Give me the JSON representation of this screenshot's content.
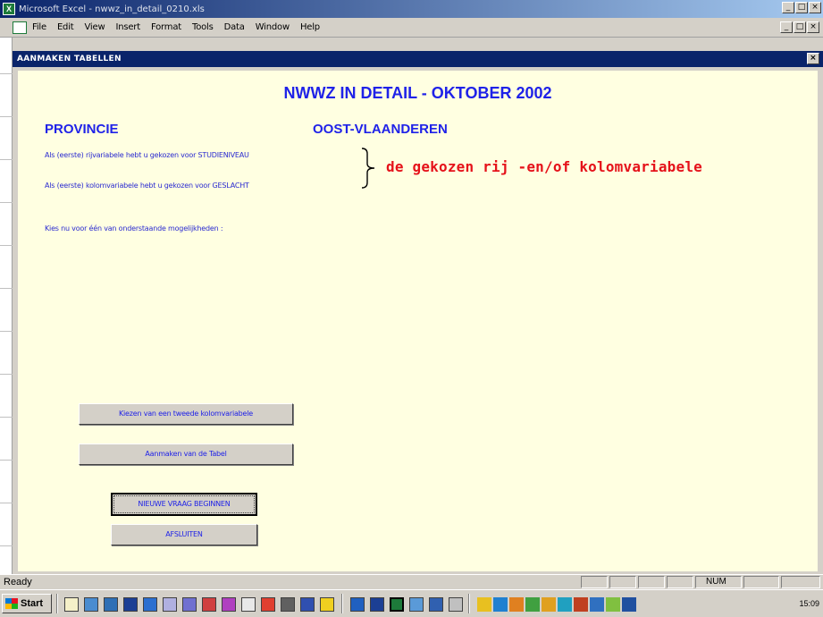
{
  "app": {
    "title": "Microsoft Excel - nwwz_in_detail_0210.xls",
    "menu": [
      "File",
      "Edit",
      "View",
      "Insert",
      "Format",
      "Tools",
      "Data",
      "Window",
      "Help"
    ],
    "win_buttons": [
      "_",
      "□",
      "×"
    ]
  },
  "dialog": {
    "title": "AANMAKEN TABELLEN",
    "close": "×",
    "heading": "NWWZ IN DETAIL - OKTOBER 2002",
    "province_label": "PROVINCIE",
    "province_value": "OOST-VLAANDEREN",
    "row_var_text": "Als (eerste) rijvariabele hebt u gekozen voor STUDIENIVEAU",
    "col_var_text": "Als (eerste) kolomvariabele hebt u gekozen voor GESLACHT",
    "choose_text": "Kies nu voor één van onderstaande mogelijkheden :",
    "annotation": "de gekozen rij -en/of kolomvariabele",
    "buttons": {
      "second_col": "Kiezen van een tweede kolomvariabele",
      "make_table": "Aanmaken van de Tabel",
      "new_question": "NIEUWE VRAAG BEGINNEN",
      "close": "AFSLUITEN"
    }
  },
  "status": {
    "ready": "Ready",
    "num": "NUM"
  },
  "taskbar": {
    "start": "Start",
    "clock": "15:09"
  },
  "colors": {
    "title_blue": "#1f22e8",
    "annotation_red": "#e5121a",
    "dialog_bg": "#ffffe1"
  }
}
